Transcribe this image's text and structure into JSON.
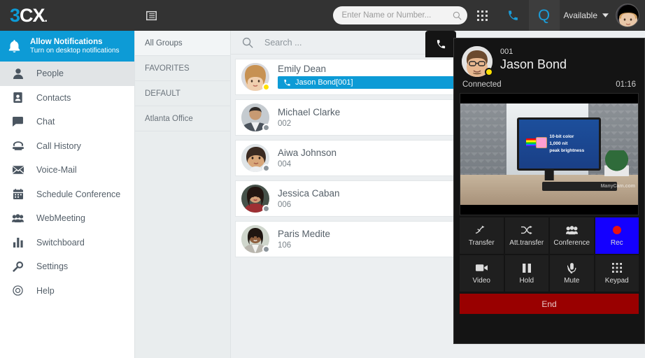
{
  "brand": {
    "logo_3": "3",
    "logo_cx": "CX",
    "logo_dot": ".",
    "accent": "#0d9bd6"
  },
  "topbar": {
    "list_icon": "list-view-icon",
    "search": {
      "placeholder": "Enter Name or Number...",
      "value": "",
      "icon": "search-icon"
    },
    "dialpad_icon": "dialpad-icon",
    "phone_icon": "phone-icon",
    "q_label": "Q",
    "status_label": "Available",
    "chevron": "chevron-down-icon",
    "avatar": "user-avatar"
  },
  "sidebar": {
    "notification": {
      "title": "Allow Notifications",
      "subtitle": "Turn on desktop notifications",
      "icon": "bell-icon"
    },
    "items": [
      {
        "label": "People",
        "icon": "person-icon",
        "active": true
      },
      {
        "label": "Contacts",
        "icon": "contacts-book-icon",
        "active": false
      },
      {
        "label": "Chat",
        "icon": "chat-bubble-icon",
        "active": false
      },
      {
        "label": "Call History",
        "icon": "old-phone-icon",
        "active": false
      },
      {
        "label": "Voice-Mail",
        "icon": "envelope-icon",
        "active": false
      },
      {
        "label": "Schedule Conference",
        "icon": "calendar-icon",
        "active": false
      },
      {
        "label": "WebMeeting",
        "icon": "group-people-icon",
        "active": false
      },
      {
        "label": "Switchboard",
        "icon": "bar-chart-icon",
        "active": false
      },
      {
        "label": "Settings",
        "icon": "wrench-icon",
        "active": false
      },
      {
        "label": "Help",
        "icon": "help-circle-icon",
        "active": false
      }
    ]
  },
  "groups": {
    "items": [
      {
        "label": "All Groups",
        "active": true
      },
      {
        "label": "FAVORITES",
        "active": false
      },
      {
        "label": "DEFAULT",
        "active": false
      },
      {
        "label": "Atlanta Office",
        "active": false
      }
    ]
  },
  "contacts": {
    "search": {
      "placeholder": "Search ...",
      "value": "",
      "icon": "search-icon"
    },
    "action_icons": [
      "phone-icon",
      "video-camera-icon",
      "chat-bubble-icon",
      "conference-icon",
      "star-icon",
      "more-dots-icon"
    ],
    "rows": [
      {
        "name": "Emily Dean",
        "extension": "",
        "presence": "Available",
        "dot_color": "#ffe000",
        "call_bar": {
          "text": "Jason Bond[001]",
          "icon": "phone-icon",
          "color": "#0d9bd6"
        },
        "avatar_colors": [
          "#e7cbb0",
          "#b98f6d"
        ]
      },
      {
        "name": "Michael Clarke",
        "extension": "002",
        "presence": "Available",
        "dot_color": "#8c959b",
        "call_bar": null,
        "avatar_colors": [
          "#9aa3ac",
          "#4c555e"
        ]
      },
      {
        "name": "Aiwa Johnson",
        "extension": "004",
        "presence": "Available",
        "dot_color": "#8c959b",
        "call_bar": null,
        "avatar_colors": [
          "#d8b79b",
          "#a87f61"
        ]
      },
      {
        "name": "Jessica Caban",
        "extension": "006",
        "presence": "Available",
        "dot_color": "#8c959b",
        "call_bar": null,
        "avatar_colors": [
          "#3b2b28",
          "#8e4a44"
        ]
      },
      {
        "name": "Paris Medite",
        "extension": "106",
        "presence": "Available",
        "dot_color": "#8c959b",
        "call_bar": null,
        "avatar_colors": [
          "#9a8f85",
          "#5a4b42"
        ]
      }
    ]
  },
  "call_panel": {
    "tab_icon": "phone-icon",
    "extension": "001",
    "name": "Jason Bond",
    "status": "Connected",
    "timer": "01:16",
    "dot_color": "#ffe000",
    "video": {
      "screen_text_line1": "10-bit color",
      "screen_text_line2": "1,000 nit",
      "screen_text_line3": "peak brightness",
      "watermark": "ManyCam.com"
    },
    "buttons": [
      {
        "label": "Transfer",
        "icon": "transfer-arrow-icon",
        "active": false
      },
      {
        "label": "Att.transfer",
        "icon": "attended-transfer-icon",
        "active": false
      },
      {
        "label": "Conference",
        "icon": "conference-icon",
        "active": false
      },
      {
        "label": "Rec",
        "icon": "record-dot-icon",
        "active": true,
        "color": "#1400ff"
      },
      {
        "label": "Video",
        "icon": "video-camera-icon",
        "active": false
      },
      {
        "label": "Hold",
        "icon": "pause-icon",
        "active": false
      },
      {
        "label": "Mute",
        "icon": "mute-microphone-icon",
        "active": false
      },
      {
        "label": "Keypad",
        "icon": "dialpad-icon",
        "active": false
      }
    ],
    "end_label": "End",
    "end_color": "#990000"
  }
}
